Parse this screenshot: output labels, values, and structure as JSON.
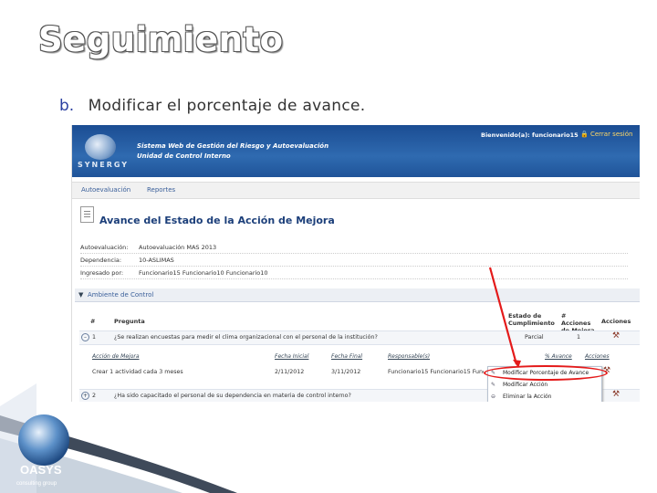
{
  "slide": {
    "title": "Seguimiento",
    "bullet_marker": "b.",
    "bullet_text": "Modificar el porcentaje de avance."
  },
  "app": {
    "logo_text": "SYNERGY",
    "system_title": "Sistema Web de Gestión del Riesgo y Autoevaluación",
    "unit": "Unidad de Control Interno",
    "welcome": "Bienvenido(a): funcionario15",
    "close_session": "Cerrar sesión"
  },
  "menu": [
    "Autoevaluación",
    "Reportes"
  ],
  "page": {
    "heading": "Avance del Estado de la Acción de Mejora"
  },
  "info": [
    {
      "label": "Autoevaluación:",
      "value": "Autoevaluación MAS 2013"
    },
    {
      "label": "Dependencia:",
      "value": "10-ASLIMAS"
    },
    {
      "label": "Ingresado por:",
      "value": "Funcionario15 Funcionario10 Funcionario10"
    }
  ],
  "section": {
    "label": "Ambiente de Control"
  },
  "table": {
    "headers": {
      "num": "#",
      "question": "Pregunta",
      "status": "Estado de Cumplimiento",
      "actions_count": "# Acciones de Mejora",
      "actions": "Acciones"
    },
    "rows": [
      {
        "num": "1",
        "question": "¿Se realizan encuestas para medir el clima organizacional con el personal de la institución?",
        "status": "Parcial",
        "count": "1"
      },
      {
        "num": "2",
        "question": "¿Ha sido capacitado el personal de su dependencia en materia de control interno?",
        "status": "",
        "count": ""
      }
    ],
    "sub_headers": {
      "action": "Acción de Mejora",
      "start": "Fecha Inicial",
      "end": "Fecha Final",
      "responsible": "Responsable(s)",
      "progress": "% Avance",
      "actions": "Acciones"
    },
    "sub_row": {
      "action": "Crear 1 actividad cada 3 meses",
      "start": "2/11/2012",
      "end": "3/11/2012",
      "responsible": "Funcionario15 Funcionario15 Funcionario10"
    }
  },
  "context_menu": {
    "items": [
      {
        "icon": "✎",
        "label": "Modificar Porcentaje de Avance"
      },
      {
        "icon": "✎",
        "label": "Modificar Acción"
      },
      {
        "icon": "⊖",
        "label": "Eliminar la Acción"
      }
    ]
  },
  "brand": {
    "name": "OASYS",
    "tagline": "consulting group"
  },
  "colors": {
    "banner": "#1f5499",
    "highlight": "#e41a1a",
    "heading": "#1c3f7a"
  }
}
